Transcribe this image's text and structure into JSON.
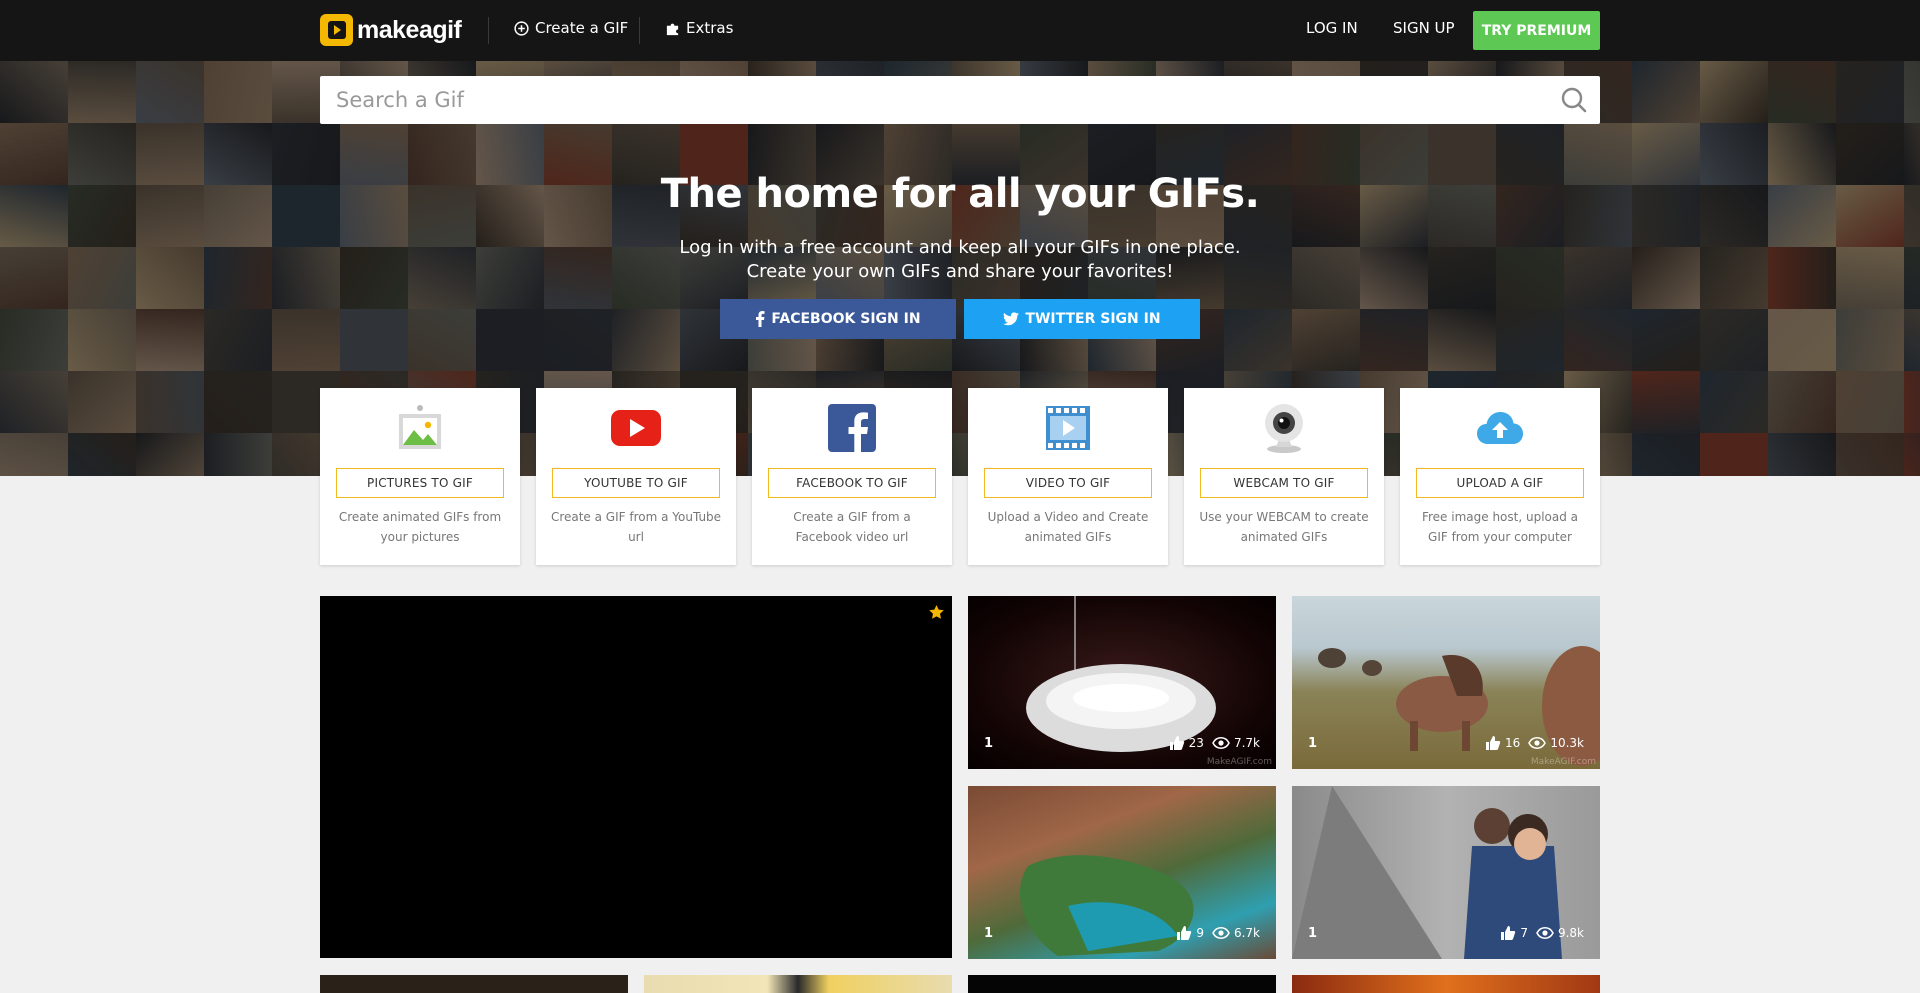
{
  "nav": {
    "logo_text": "makeagif",
    "create_label": "Create a GIF",
    "extras_label": "Extras",
    "login_label": "LOG IN",
    "signup_label": "SIGN UP",
    "premium_label": "TRY PREMIUM"
  },
  "search": {
    "placeholder": "Search a Gif"
  },
  "hero": {
    "title": "The home for all your GIFs.",
    "line1": "Log in with a free account and keep all your GIFs in one place.",
    "line2": "Create your own GIFs and share your favorites!",
    "facebook_label": "FACEBOOK SIGN IN",
    "twitter_label": "TWITTER SIGN IN"
  },
  "tools": [
    {
      "icon": "pictures-icon",
      "label": "PICTURES TO GIF",
      "desc": "Create animated GIFs from your pictures"
    },
    {
      "icon": "youtube-icon",
      "label": "YOUTUBE TO GIF",
      "desc": "Create a GIF from a YouTube url"
    },
    {
      "icon": "facebook-icon",
      "label": "FACEBOOK TO GIF",
      "desc": "Create a GIF from a Facebook video url"
    },
    {
      "icon": "video-icon",
      "label": "VIDEO TO GIF",
      "desc": "Upload a Video and Create animated GIFs"
    },
    {
      "icon": "webcam-icon",
      "label": "WEBCAM TO GIF",
      "desc": "Use your WEBCAM to create animated GIFs"
    },
    {
      "icon": "upload-icon",
      "label": "UPLOAD A GIF",
      "desc": "Free image host, upload a GIF from your computer"
    }
  ],
  "gifs": [
    {
      "count": "1",
      "likes": "23",
      "views": "7.7k",
      "watermark": "MakeAGIF.com"
    },
    {
      "count": "1",
      "likes": "16",
      "views": "10.3k",
      "watermark": "MakeAGIF.com"
    },
    {
      "count": "1",
      "likes": "9",
      "views": "6.7k"
    },
    {
      "count": "1",
      "likes": "7",
      "views": "9.8k"
    }
  ],
  "colors": {
    "premium": "#5dc954",
    "facebook": "#3b5998",
    "twitter": "#1da1f2",
    "accent": "#f0bb1e",
    "nav_bg": "#151515"
  }
}
